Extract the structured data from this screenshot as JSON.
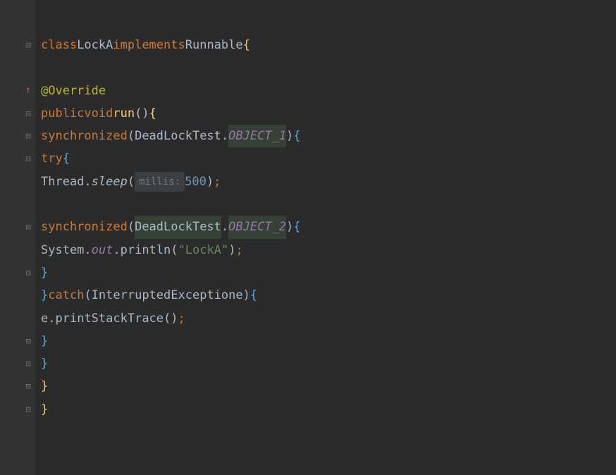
{
  "code": {
    "line1": {
      "kw1": "class",
      "name": "LockA",
      "kw2": "implements",
      "iface": "Runnable",
      "brace": "{"
    },
    "line3": {
      "annotation": "@Override"
    },
    "line4": {
      "kw1": "public",
      "kw2": "void",
      "method": "run",
      "parens": "()",
      "brace": "{"
    },
    "line5": {
      "kw": "synchronized",
      "paren_open": "(",
      "cls": "DeadLockTest",
      "dot": ".",
      "field": "OBJECT_1",
      "paren_close": ")",
      "brace": "{"
    },
    "line6": {
      "kw": "try",
      "brace": "{"
    },
    "line7": {
      "cls": "Thread",
      "dot": ".",
      "method": "sleep",
      "paren_open": "(",
      "hint": "millis:",
      "num": "500",
      "paren_close": ")",
      "semi": ";"
    },
    "line9": {
      "kw": "synchronized",
      "paren_open": "(",
      "cls": "DeadLockTest",
      "dot": ".",
      "field": "OBJECT_2",
      "paren_close": ")",
      "brace": "{"
    },
    "line10": {
      "cls": "System",
      "dot1": ".",
      "field": "out",
      "dot2": ".",
      "method": "println",
      "paren_open": "(",
      "str": "\"LockA\"",
      "paren_close": ")",
      "semi": ";"
    },
    "line11": {
      "brace": "}"
    },
    "line12": {
      "brace1": "}",
      "kw": "catch",
      "paren_open": "(",
      "exc": "InterruptedException",
      "var": "e",
      "paren_close": ")",
      "brace2": "{"
    },
    "line13": {
      "var": "e",
      "dot": ".",
      "method": "printStackTrace",
      "parens": "()",
      "semi": ";"
    },
    "line14": {
      "brace": "}"
    },
    "line15": {
      "brace": "}"
    },
    "line16": {
      "brace": "}"
    },
    "line17": {
      "brace": "}"
    }
  },
  "gutter": {
    "fold": "⊟",
    "arrow": "↑"
  }
}
